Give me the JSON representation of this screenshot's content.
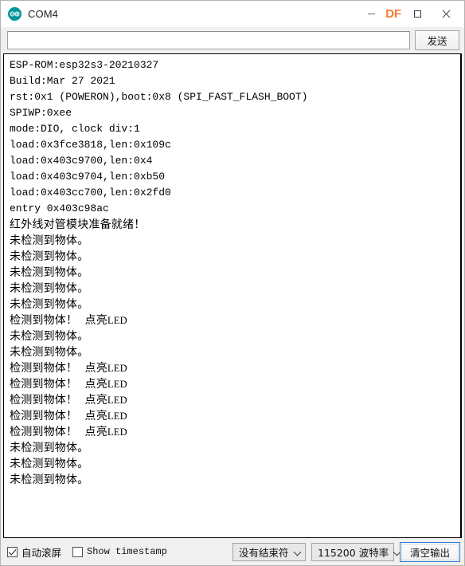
{
  "window": {
    "title": "COM4",
    "app_icon": "arduino-logo-icon",
    "controls": {
      "minimize": "minimize-icon",
      "brand_logo": "DF",
      "maximize": "maximize-icon",
      "close": "close-icon"
    },
    "brand_color": "#f07c32"
  },
  "send_row": {
    "input_value": "",
    "input_placeholder": "",
    "send_label": "发送"
  },
  "console": {
    "lines": [
      {
        "text": "ESP-ROM:esp32s3-20210327",
        "cjk": false
      },
      {
        "text": "Build:Mar 27 2021",
        "cjk": false
      },
      {
        "text": "rst:0x1 (POWERON),boot:0x8 (SPI_FAST_FLASH_BOOT)",
        "cjk": false
      },
      {
        "text": "SPIWP:0xee",
        "cjk": false
      },
      {
        "text": "mode:DIO, clock div:1",
        "cjk": false
      },
      {
        "text": "load:0x3fce3818,len:0x109c",
        "cjk": false
      },
      {
        "text": "load:0x403c9700,len:0x4",
        "cjk": false
      },
      {
        "text": "load:0x403c9704,len:0xb50",
        "cjk": false
      },
      {
        "text": "load:0x403cc700,len:0x2fd0",
        "cjk": false
      },
      {
        "text": "entry 0x403c98ac",
        "cjk": false
      },
      {
        "text": "红外线对管模块准备就绪！",
        "cjk": true
      },
      {
        "text": "未检测到物体。",
        "cjk": true
      },
      {
        "text": "未检测到物体。",
        "cjk": true
      },
      {
        "text": "未检测到物体。",
        "cjk": true
      },
      {
        "text": "未检测到物体。",
        "cjk": true
      },
      {
        "text": "未检测到物体。",
        "cjk": true
      },
      {
        "text": "检测到物体！  点亮",
        "tail": "LED",
        "cjk": true
      },
      {
        "text": "未检测到物体。",
        "cjk": true
      },
      {
        "text": "未检测到物体。",
        "cjk": true
      },
      {
        "text": "检测到物体！  点亮",
        "tail": "LED",
        "cjk": true
      },
      {
        "text": "检测到物体！  点亮",
        "tail": "LED",
        "cjk": true
      },
      {
        "text": "检测到物体！  点亮",
        "tail": "LED",
        "cjk": true
      },
      {
        "text": "检测到物体！  点亮",
        "tail": "LED",
        "cjk": true
      },
      {
        "text": "检测到物体！  点亮",
        "tail": "LED",
        "cjk": true
      },
      {
        "text": "未检测到物体。",
        "cjk": true
      },
      {
        "text": "未检测到物体。",
        "cjk": true
      },
      {
        "text": "未检测到物体。",
        "cjk": true
      }
    ]
  },
  "status_bar": {
    "autoscroll_label": "自动滚屏",
    "autoscroll_checked": true,
    "timestamp_label": "Show timestamp",
    "timestamp_checked": false,
    "line_ending": "没有结束符",
    "baud_rate": "115200 波特率",
    "clear_label": "清空输出"
  }
}
